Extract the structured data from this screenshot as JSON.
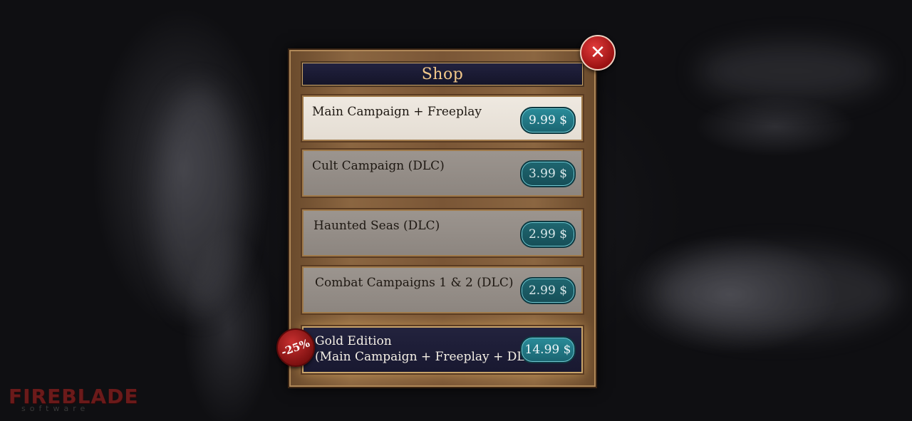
{
  "shop": {
    "title": "Shop",
    "close_icon": "close-icon",
    "items": [
      {
        "label": "Main Campaign + Freeplay",
        "price": "9.99 $"
      },
      {
        "label": "Cult Campaign (DLC)",
        "price": "3.99 $"
      },
      {
        "label": "Haunted Seas (DLC)",
        "price": "2.99 $"
      },
      {
        "label": "Combat Campaigns 1 & 2 (DLC)",
        "price": "2.99 $"
      },
      {
        "label_line1": "Gold Edition",
        "label_line2": "(Main Campaign + Freeplay + DLCs)",
        "price": "14.99 $",
        "discount": "-25%"
      }
    ]
  },
  "logo": {
    "main": "FIREBLADE",
    "sub": "software"
  },
  "colors": {
    "price_badge": "#1a6470",
    "title_text": "#f2c88a",
    "close_button": "#b01818"
  }
}
